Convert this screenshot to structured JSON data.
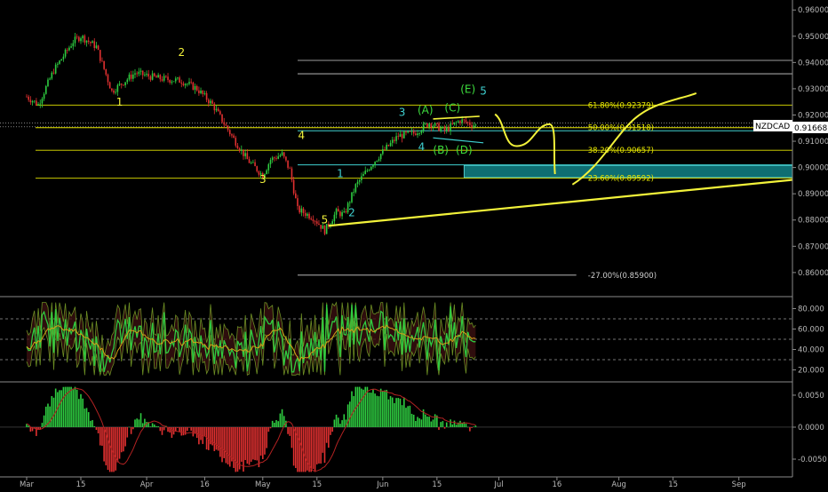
{
  "chart_data": {
    "type": "candlestick",
    "symbol": "NZDCAD",
    "last_price": "0.91668",
    "colors": {
      "background": "#000000",
      "axis_text": "#b8b8b8",
      "up": "#2ecc40",
      "down": "#e03030",
      "fib": "#e6e600",
      "annotation_yellow": "#f2f23a",
      "annotation_cyan": "#3fd0d0",
      "annotation_green": "#3ddc3d",
      "zone": "#0e6e72",
      "price_label_bg": "#ffffff",
      "rsi": "#2ecc40",
      "bands": "#6b8e23",
      "macd_signal": "#b22222"
    },
    "price_axis": {
      "ylim": [
        0.8515,
        0.9638
      ],
      "ticks": [
        "0.96000",
        "0.95000",
        "0.94000",
        "0.93000",
        "0.92000",
        "0.91000",
        "0.90000",
        "0.89000",
        "0.88000",
        "0.87000",
        "0.86000"
      ],
      "tick_values": [
        0.96,
        0.95,
        0.94,
        0.93,
        0.92,
        0.91,
        0.9,
        0.89,
        0.88,
        0.87,
        0.86
      ]
    },
    "rsi_axis": {
      "ylim": [
        10,
        90
      ],
      "ticks": [
        "80.000",
        "60.000",
        "40.000",
        "20.000"
      ],
      "tick_values": [
        80,
        60,
        40,
        20
      ],
      "dashed_levels": [
        70,
        50,
        30
      ]
    },
    "macd_axis": {
      "ylim": [
        -0.0075,
        0.0068
      ],
      "ticks": [
        "0.0050",
        "0.0000",
        "-0.0050"
      ],
      "tick_values": [
        0.005,
        0.0,
        -0.005
      ]
    },
    "x_axis": {
      "labels": [
        "Mar",
        "15",
        "Apr",
        "16",
        "May",
        "15",
        "Jun",
        "15",
        "Jul",
        "16",
        "Aug",
        "15",
        "Sep"
      ],
      "day_index": [
        0,
        14,
        31,
        46,
        61,
        75,
        92,
        106,
        122,
        137,
        153,
        167,
        184
      ]
    },
    "candles": {
      "start_day": 0,
      "end_day": 116,
      "anchors": [
        [
          0,
          0.927
        ],
        [
          3,
          0.924
        ],
        [
          7,
          0.937
        ],
        [
          12,
          0.948
        ],
        [
          14,
          0.95
        ],
        [
          18,
          0.946
        ],
        [
          22,
          0.929
        ],
        [
          28,
          0.936
        ],
        [
          34,
          0.934
        ],
        [
          40,
          0.933
        ],
        [
          44,
          0.93
        ],
        [
          48,
          0.924
        ],
        [
          53,
          0.912
        ],
        [
          57,
          0.903
        ],
        [
          61,
          0.897
        ],
        [
          63,
          0.903
        ],
        [
          66,
          0.905
        ],
        [
          68,
          0.899
        ],
        [
          70,
          0.884
        ],
        [
          74,
          0.881
        ],
        [
          77,
          0.876
        ],
        [
          80,
          0.883
        ],
        [
          82,
          0.882
        ],
        [
          85,
          0.893
        ],
        [
          89,
          0.901
        ],
        [
          92,
          0.906
        ],
        [
          96,
          0.912
        ],
        [
          100,
          0.913
        ],
        [
          104,
          0.917
        ],
        [
          108,
          0.914
        ],
        [
          112,
          0.918
        ],
        [
          116,
          0.916
        ]
      ]
    },
    "fib_levels": [
      {
        "label": "61.80%(0.92379)",
        "value": 0.92379
      },
      {
        "label": "50.00%(0.91518)",
        "value": 0.91518
      },
      {
        "label": "38.20%(0.90657)",
        "value": 0.90657
      },
      {
        "label": "23.60%(0.89592)",
        "value": 0.89592
      },
      {
        "label": "-27.00%(0.85900)",
        "value": 0.859
      }
    ],
    "horizontal_lines": [
      {
        "value": 0.9408,
        "from_day": 70
      },
      {
        "value": 0.9357,
        "from_day": 70
      }
    ],
    "wave_labels": [
      {
        "text": "1",
        "day": 24,
        "value": 0.9235,
        "color": "yellow"
      },
      {
        "text": "2",
        "day": 40,
        "value": 0.9425,
        "color": "yellow"
      },
      {
        "text": "3",
        "day": 61,
        "value": 0.8942,
        "color": "yellow"
      },
      {
        "text": "4",
        "day": 71,
        "value": 0.9108,
        "color": "yellow"
      },
      {
        "text": "5",
        "day": 77,
        "value": 0.8787,
        "color": "yellow"
      },
      {
        "text": "1",
        "day": 81,
        "value": 0.8964,
        "color": "cyan"
      },
      {
        "text": "2",
        "day": 84,
        "value": 0.8814,
        "color": "cyan"
      },
      {
        "text": "3",
        "day": 97,
        "value": 0.9197,
        "color": "cyan"
      },
      {
        "text": "4",
        "day": 102,
        "value": 0.9064,
        "color": "cyan"
      },
      {
        "text": "(A)",
        "day": 103,
        "value": 0.9205,
        "color": "green"
      },
      {
        "text": "(B)",
        "day": 107,
        "value": 0.9053,
        "color": "green"
      },
      {
        "text": "(C)",
        "day": 110,
        "value": 0.9213,
        "color": "green"
      },
      {
        "text": "(D)",
        "day": 113,
        "value": 0.9053,
        "color": "green"
      },
      {
        "text": "(E)",
        "day": 114,
        "value": 0.9284,
        "color": "green"
      },
      {
        "text": "5",
        "day": 118,
        "value": 0.9278,
        "color": "cyan"
      }
    ]
  }
}
